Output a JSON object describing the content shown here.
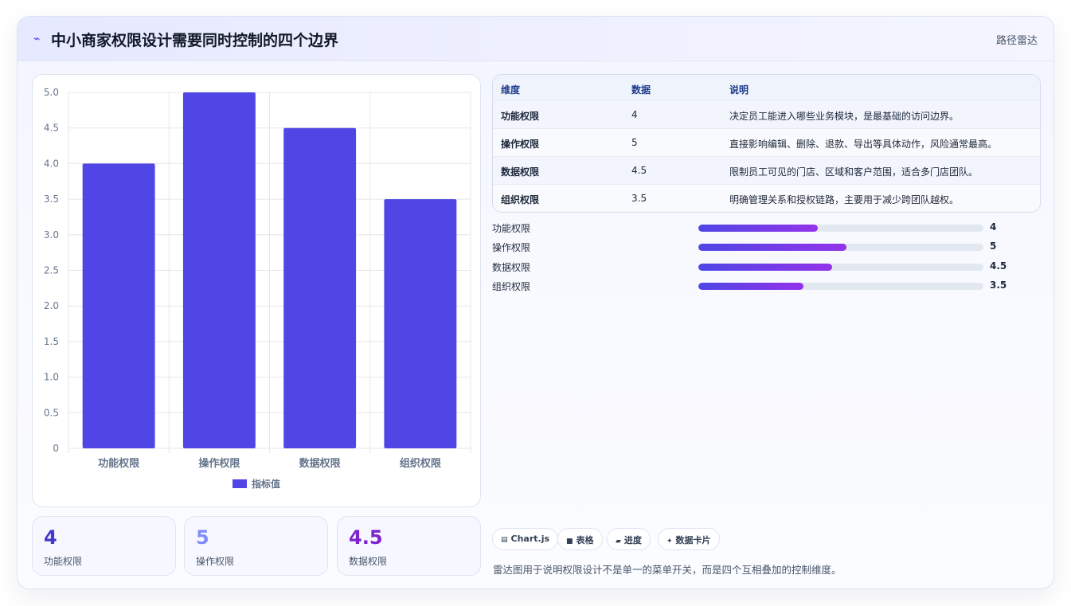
{
  "header": {
    "icon": "sparkle-icon",
    "title": "中小商家权限设计需要同时控制的四个边界",
    "tag": "路径雷达"
  },
  "chart_data": {
    "type": "bar",
    "categories": [
      "功能权限",
      "操作权限",
      "数据权限",
      "组织权限"
    ],
    "series": [
      {
        "name": "指标值",
        "values": [
          4,
          5,
          4.5,
          3.5
        ]
      }
    ],
    "ylim": [
      0,
      5
    ],
    "yticks": [
      "0",
      "0.5",
      "1.0",
      "1.5",
      "2.0",
      "2.5",
      "3.0",
      "3.5",
      "4.0",
      "4.5",
      "5.0"
    ],
    "grid": true,
    "legend_position": "bottom",
    "color": "#4f46e5"
  },
  "table": {
    "headers": [
      "维度",
      "数据",
      "说明"
    ],
    "rows": [
      [
        "功能权限",
        "4",
        "决定员工能进入哪些业务模块，是最基础的访问边界。"
      ],
      [
        "操作权限",
        "5",
        "直接影响编辑、删除、退款、导出等具体动作，风险通常最高。"
      ],
      [
        "数据权限",
        "4.5",
        "限制员工可见的门店、区域和客户范围，适合多门店团队。"
      ],
      [
        "组织权限",
        "3.5",
        "明确管理关系和授权链路，主要用于减少跨团队越权。"
      ]
    ]
  },
  "progress": [
    {
      "label": "功能权限",
      "value": "4",
      "fraction": 0.42
    },
    {
      "label": "操作权限",
      "value": "5",
      "fraction": 0.52
    },
    {
      "label": "数据权限",
      "value": "4.5",
      "fraction": 0.47
    },
    {
      "label": "组织权限",
      "value": "3.5",
      "fraction": 0.37
    }
  ],
  "stats": [
    {
      "value": "4",
      "label": "功能权限",
      "color": "#4338ca"
    },
    {
      "value": "5",
      "label": "操作权限",
      "color": "#818cf8"
    },
    {
      "value": "4.5",
      "label": "数据权限",
      "color": "#7e22ce"
    }
  ],
  "pills": [
    {
      "icon": "chart-icon",
      "label": "Chart.js"
    },
    {
      "icon": "table-icon",
      "label": "表格"
    },
    {
      "icon": "progress-icon",
      "label": "进度"
    },
    {
      "icon": "sparkle-icon",
      "label": "数据卡片"
    }
  ],
  "note": "雷达图用于说明权限设计不是单一的菜单开关，而是四个互相叠加的控制维度。"
}
